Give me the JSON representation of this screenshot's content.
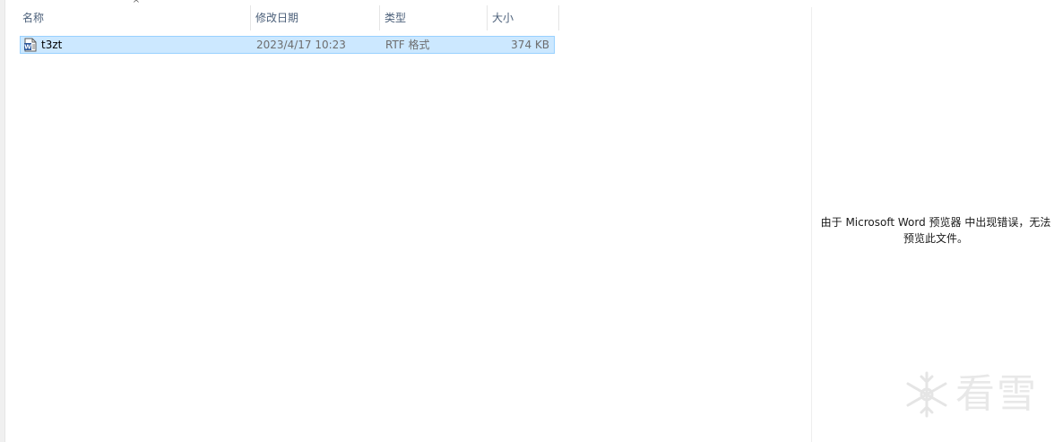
{
  "columns": {
    "name": "名称",
    "date": "修改日期",
    "type": "类型",
    "size": "大小"
  },
  "files": [
    {
      "icon": "rtf-document-icon",
      "name": "t3zt",
      "date": "2023/4/17 10:23",
      "type": "RTF 格式",
      "size": "374 KB",
      "selected": true
    }
  ],
  "preview": {
    "line1": "由于 Microsoft Word 预览器 中出现错误，无法",
    "line2": "预览此文件。"
  },
  "watermark": {
    "text": "看雪"
  },
  "colors": {
    "selection_bg": "#cce8ff",
    "selection_border": "#99d1ff",
    "header_text": "#4c607a"
  }
}
